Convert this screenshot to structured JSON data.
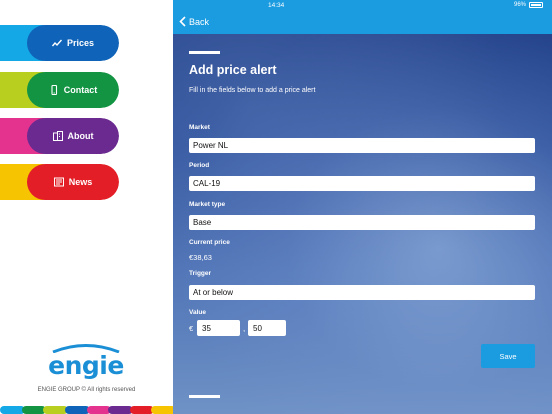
{
  "sidebar": {
    "items": [
      {
        "label": "Prices",
        "icon": "chart-line-icon",
        "accent": "#14a8e6",
        "pill": "#0f63b8"
      },
      {
        "label": "Contact",
        "icon": "phone-icon",
        "accent": "#b8cf1f",
        "pill": "#139443"
      },
      {
        "label": "About",
        "icon": "building-icon",
        "accent": "#e3338e",
        "pill": "#6a2a8f"
      },
      {
        "label": "News",
        "icon": "newspaper-icon",
        "accent": "#f6c400",
        "pill": "#e31e26"
      }
    ],
    "logo": "ENGIE",
    "copyright": "ENGIE GROUP © All rights reserved"
  },
  "colors": {
    "bar": [
      "#14a8e6",
      "#139443",
      "#b8cf1f",
      "#0f63b8",
      "#e3338e",
      "#6a2a8f",
      "#e31e26",
      "#f6c400"
    ],
    "topbar": "#1b9be0"
  },
  "status": {
    "time": "14:34",
    "battery": "96%"
  },
  "nav": {
    "back": "Back"
  },
  "form": {
    "title": "Add price alert",
    "subtitle": "Fill in the fields below to add a price alert",
    "market_label": "Market",
    "market_value": "Power NL",
    "period_label": "Period",
    "period_value": "CAL-19",
    "market_type_label": "Market type",
    "market_type_value": "Base",
    "current_price_label": "Current price",
    "current_price_value": "€38,63",
    "trigger_label": "Trigger",
    "trigger_value": "At or below",
    "value_label": "Value",
    "currency": "€",
    "value_whole": "35",
    "decimal_separator": ",",
    "value_decimal": "50",
    "save_label": "Save"
  }
}
